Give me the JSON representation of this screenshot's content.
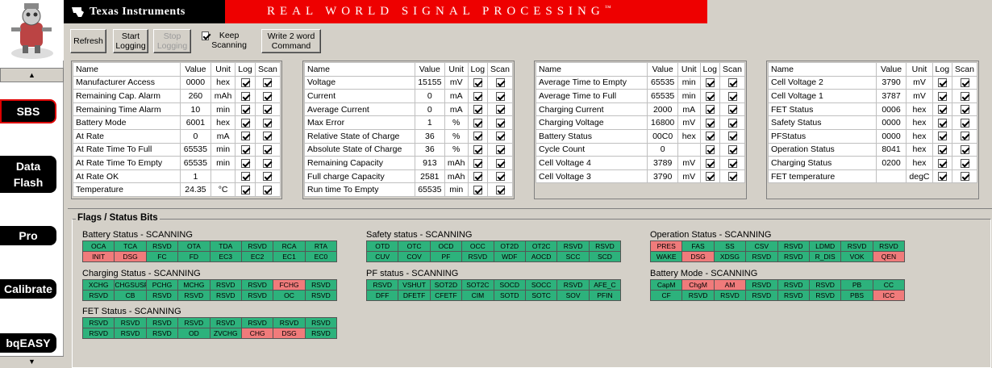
{
  "brand": {
    "company": "Texas Instruments",
    "slogan": "Real World Signal Processing",
    "tm": "™",
    "accent": "#e00000"
  },
  "sidebar": {
    "scroll_up": "▲",
    "scroll_down": "▼",
    "items": [
      {
        "label": "SBS",
        "active": true
      },
      {
        "label": "Data\nFlash"
      },
      {
        "label": "Pro"
      },
      {
        "label": "Calibrate"
      },
      {
        "label": "bqEASY"
      }
    ]
  },
  "toolbar": {
    "refresh": "Refresh",
    "start_logging": "Start\nLogging",
    "stop_logging": "Stop\nLogging",
    "keep_scanning": "Keep\nScanning",
    "keep_scanning_checked": true,
    "write_word": "Write 2 word\nCommand"
  },
  "tables": [
    {
      "header": [
        "Name",
        "Value",
        "Unit",
        "Log",
        "Scan"
      ],
      "rows": [
        [
          "Manufacturer Access",
          "0000",
          "hex",
          true,
          true
        ],
        [
          "Remaining Cap. Alarm",
          "260",
          "mAh",
          true,
          true
        ],
        [
          "Remaining Time Alarm",
          "10",
          "min",
          true,
          true
        ],
        [
          "Battery Mode",
          "6001",
          "hex",
          true,
          true
        ],
        [
          "At Rate",
          "0",
          "mA",
          true,
          true
        ],
        [
          "At Rate Time To Full",
          "65535",
          "min",
          true,
          true
        ],
        [
          "At Rate Time To Empty",
          "65535",
          "min",
          true,
          true
        ],
        [
          "At Rate OK",
          "1",
          "",
          true,
          true
        ],
        [
          "Temperature",
          "24.35",
          "°C",
          true,
          true
        ]
      ]
    },
    {
      "header": [
        "Name",
        "Value",
        "Unit",
        "Log",
        "Scan"
      ],
      "rows": [
        [
          "Voltage",
          "15155",
          "mV",
          true,
          true
        ],
        [
          "Current",
          "0",
          "mA",
          true,
          true
        ],
        [
          "Average Current",
          "0",
          "mA",
          true,
          true
        ],
        [
          "Max Error",
          "1",
          "%",
          true,
          true
        ],
        [
          "Relative State of Charge",
          "36",
          "%",
          true,
          true
        ],
        [
          "Absolute State of Charge",
          "36",
          "%",
          true,
          true
        ],
        [
          "Remaining Capacity",
          "913",
          "mAh",
          true,
          true
        ],
        [
          "Full charge Capacity",
          "2581",
          "mAh",
          true,
          true
        ],
        [
          "Run time To Empty",
          "65535",
          "min",
          true,
          true
        ]
      ]
    },
    {
      "header": [
        "Name",
        "Value",
        "Unit",
        "Log",
        "Scan"
      ],
      "rows": [
        [
          "Average Time to Empty",
          "65535",
          "min",
          true,
          true
        ],
        [
          "Average Time to Full",
          "65535",
          "min",
          true,
          true
        ],
        [
          "Charging Current",
          "2000",
          "mA",
          true,
          true
        ],
        [
          "Charging Voltage",
          "16800",
          "mV",
          true,
          true
        ],
        [
          "Battery Status",
          "00C0",
          "hex",
          true,
          true
        ],
        [
          "Cycle Count",
          "0",
          "",
          true,
          true
        ],
        [
          "Cell Voltage 4",
          "3789",
          "mV",
          true,
          true
        ],
        [
          "Cell Voltage 3",
          "3790",
          "mV",
          true,
          true
        ]
      ]
    },
    {
      "header": [
        "Name",
        "Value",
        "Unit",
        "Log",
        "Scan"
      ],
      "rows": [
        [
          "Cell Voltage 2",
          "3790",
          "mV",
          true,
          true
        ],
        [
          "Cell Voltage 1",
          "3787",
          "mV",
          true,
          true
        ],
        [
          "FET Status",
          "0006",
          "hex",
          true,
          true
        ],
        [
          "Safety Status",
          "0000",
          "hex",
          true,
          true
        ],
        [
          "PFStatus",
          "0000",
          "hex",
          true,
          true
        ],
        [
          "Operation Status",
          "8041",
          "hex",
          true,
          true
        ],
        [
          "Charging Status",
          "0200",
          "hex",
          true,
          true
        ],
        [
          "FET temperature",
          "",
          "degC",
          true,
          true
        ]
      ]
    }
  ],
  "flags": {
    "title": "Flags / Status Bits",
    "colors": {
      "clear": "#2db27c",
      "set": "#f07b7b"
    },
    "groups": [
      {
        "title": "Battery Status - SCANNING",
        "rows": [
          [
            [
              "OCA",
              0
            ],
            [
              "TCA",
              0
            ],
            [
              "RSVD",
              0
            ],
            [
              "OTA",
              0
            ],
            [
              "TDA",
              0
            ],
            [
              "RSVD",
              0
            ],
            [
              "RCA",
              0
            ],
            [
              "RTA",
              0
            ]
          ],
          [
            [
              "INIT",
              1
            ],
            [
              "DSG",
              1
            ],
            [
              "FC",
              0
            ],
            [
              "FD",
              0
            ],
            [
              "EC3",
              0
            ],
            [
              "EC2",
              0
            ],
            [
              "EC1",
              0
            ],
            [
              "EC0",
              0
            ]
          ]
        ]
      },
      {
        "title": "Charging Status - SCANNING",
        "rows": [
          [
            [
              "XCHG",
              0
            ],
            [
              "CHGSUSP",
              0
            ],
            [
              "PCHG",
              0
            ],
            [
              "MCHG",
              0
            ],
            [
              "RSVD",
              0
            ],
            [
              "RSVD",
              0
            ],
            [
              "FCHG",
              1
            ],
            [
              "RSVD",
              0
            ]
          ],
          [
            [
              "RSVD",
              0
            ],
            [
              "CB",
              0
            ],
            [
              "RSVD",
              0
            ],
            [
              "RSVD",
              0
            ],
            [
              "RSVD",
              0
            ],
            [
              "RSVD",
              0
            ],
            [
              "OC",
              0
            ],
            [
              "RSVD",
              0
            ]
          ]
        ]
      },
      {
        "title": "FET Status - SCANNING",
        "rows": [
          [
            [
              "RSVD",
              0
            ],
            [
              "RSVD",
              0
            ],
            [
              "RSVD",
              0
            ],
            [
              "RSVD",
              0
            ],
            [
              "RSVD",
              0
            ],
            [
              "RSVD",
              0
            ],
            [
              "RSVD",
              0
            ],
            [
              "RSVD",
              0
            ]
          ],
          [
            [
              "RSVD",
              0
            ],
            [
              "RSVD",
              0
            ],
            [
              "RSVD",
              0
            ],
            [
              "OD",
              0
            ],
            [
              "ZVCHG",
              0
            ],
            [
              "CHG",
              1
            ],
            [
              "DSG",
              1
            ],
            [
              "RSVD",
              0
            ]
          ]
        ]
      },
      {
        "title": "Safety status - SCANNING",
        "rows": [
          [
            [
              "OTD",
              0
            ],
            [
              "OTC",
              0
            ],
            [
              "OCD",
              0
            ],
            [
              "OCC",
              0
            ],
            [
              "OT2D",
              0
            ],
            [
              "OT2C",
              0
            ],
            [
              "RSVD",
              0
            ],
            [
              "RSVD",
              0
            ]
          ],
          [
            [
              "CUV",
              0
            ],
            [
              "COV",
              0
            ],
            [
              "PF",
              0
            ],
            [
              "RSVD",
              0
            ],
            [
              "WDF",
              0
            ],
            [
              "AOCD",
              0
            ],
            [
              "SCC",
              0
            ],
            [
              "SCD",
              0
            ]
          ]
        ]
      },
      {
        "title": "PF status - SCANNING",
        "rows": [
          [
            [
              "RSVD",
              0
            ],
            [
              "VSHUT",
              0
            ],
            [
              "SOT2D",
              0
            ],
            [
              "SOT2C",
              0
            ],
            [
              "SOCD",
              0
            ],
            [
              "SOCC",
              0
            ],
            [
              "RSVD",
              0
            ],
            [
              "AFE_C",
              0
            ]
          ],
          [
            [
              "DFF",
              0
            ],
            [
              "DFETF",
              0
            ],
            [
              "CFETF",
              0
            ],
            [
              "CIM",
              0
            ],
            [
              "SOTD",
              0
            ],
            [
              "SOTC",
              0
            ],
            [
              "SOV",
              0
            ],
            [
              "PFIN",
              0
            ]
          ]
        ]
      },
      {
        "title": "Operation Status - SCANNING",
        "rows": [
          [
            [
              "PRES",
              1
            ],
            [
              "FAS",
              0
            ],
            [
              "SS",
              0
            ],
            [
              "CSV",
              0
            ],
            [
              "RSVD",
              0
            ],
            [
              "LDMD",
              0
            ],
            [
              "RSVD",
              0
            ],
            [
              "RSVD",
              0
            ]
          ],
          [
            [
              "WAKE",
              0
            ],
            [
              "DSG",
              1
            ],
            [
              "XDSG",
              0
            ],
            [
              "RSVD",
              0
            ],
            [
              "RSVD",
              0
            ],
            [
              "R_DIS",
              0
            ],
            [
              "VOK",
              0
            ],
            [
              "QEN",
              1
            ]
          ]
        ]
      },
      {
        "title": "Battery Mode - SCANNING",
        "rows": [
          [
            [
              "CapM",
              0
            ],
            [
              "ChgM",
              1
            ],
            [
              "AM",
              1
            ],
            [
              "RSVD",
              0
            ],
            [
              "RSVD",
              0
            ],
            [
              "RSVD",
              0
            ],
            [
              "PB",
              0
            ],
            [
              "CC",
              0
            ]
          ],
          [
            [
              "CF",
              0
            ],
            [
              "RSVD",
              0
            ],
            [
              "RSVD",
              0
            ],
            [
              "RSVD",
              0
            ],
            [
              "RSVD",
              0
            ],
            [
              "RSVD",
              0
            ],
            [
              "PBS",
              0
            ],
            [
              "ICC",
              1
            ]
          ]
        ]
      }
    ]
  }
}
